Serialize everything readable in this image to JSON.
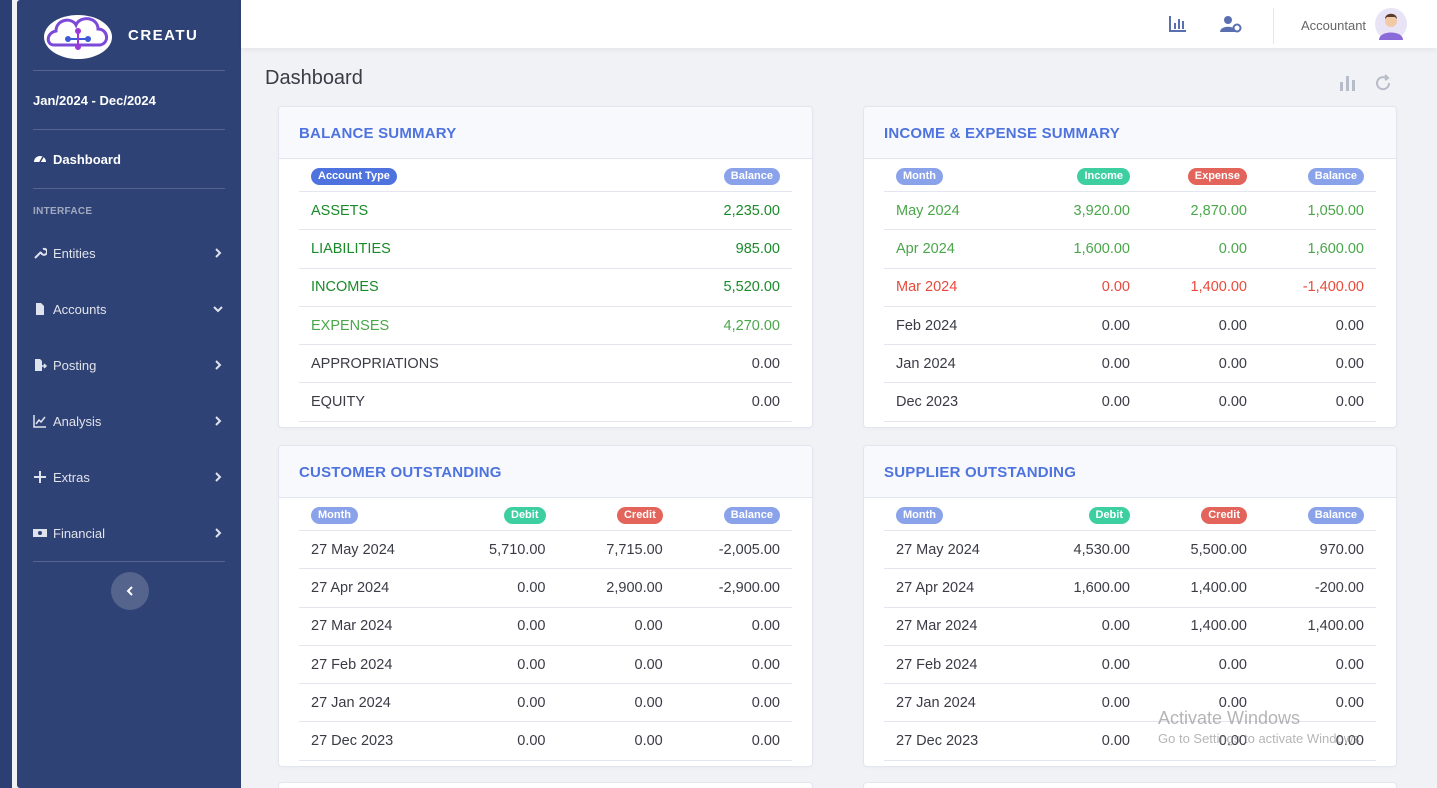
{
  "app": {
    "brand": "CREATU",
    "period": "Jan/2024 - Dec/2024"
  },
  "sidebar": {
    "dashboard_label": "Dashboard",
    "section_heading": "INTERFACE",
    "items": [
      {
        "label": "Entities",
        "icon": "wrench-icon",
        "chevron": "right"
      },
      {
        "label": "Accounts",
        "icon": "file-icon",
        "chevron": "down"
      },
      {
        "label": "Posting",
        "icon": "file-export-icon",
        "chevron": "right"
      },
      {
        "label": "Analysis",
        "icon": "chart-area-icon",
        "chevron": "right"
      },
      {
        "label": "Extras",
        "icon": "plus-icon",
        "chevron": "right"
      },
      {
        "label": "Financial",
        "icon": "money-icon",
        "chevron": "right"
      }
    ]
  },
  "topbar": {
    "user_name": "Accountant"
  },
  "page": {
    "title": "Dashboard"
  },
  "balance_summary": {
    "title": "BALANCE SUMMARY",
    "headers": [
      "Account Type",
      "Balance"
    ],
    "rows": [
      {
        "type": "ASSETS",
        "balance": "2,235.00",
        "tone": "green"
      },
      {
        "type": "LIABILITIES",
        "balance": "985.00",
        "tone": "green"
      },
      {
        "type": "INCOMES",
        "balance": "5,520.00",
        "tone": "green"
      },
      {
        "type": "EXPENSES",
        "balance": "4,270.00",
        "tone": "lgreen"
      },
      {
        "type": "APPROPRIATIONS",
        "balance": "0.00",
        "tone": "dark"
      },
      {
        "type": "EQUITY",
        "balance": "0.00",
        "tone": "dark"
      }
    ]
  },
  "income_expense_summary": {
    "title": "INCOME & EXPENSE SUMMARY",
    "headers": [
      "Month",
      "Income",
      "Expense",
      "Balance"
    ],
    "rows": [
      {
        "month": "May 2024",
        "income": "3,920.00",
        "expense": "2,870.00",
        "balance": "1,050.00",
        "tone": "lgreen"
      },
      {
        "month": "Apr 2024",
        "income": "1,600.00",
        "expense": "0.00",
        "balance": "1,600.00",
        "tone": "lgreen"
      },
      {
        "month": "Mar 2024",
        "income": "0.00",
        "expense": "1,400.00",
        "balance": "-1,400.00",
        "tone": "red"
      },
      {
        "month": "Feb 2024",
        "income": "0.00",
        "expense": "0.00",
        "balance": "0.00",
        "tone": "dark"
      },
      {
        "month": "Jan 2024",
        "income": "0.00",
        "expense": "0.00",
        "balance": "0.00",
        "tone": "dark"
      },
      {
        "month": "Dec 2023",
        "income": "0.00",
        "expense": "0.00",
        "balance": "0.00",
        "tone": "dark"
      }
    ]
  },
  "customer_outstanding": {
    "title": "CUSTOMER OUTSTANDING",
    "headers": [
      "Month",
      "Debit",
      "Credit",
      "Balance"
    ],
    "rows": [
      {
        "month": "27 May 2024",
        "debit": "5,710.00",
        "credit": "7,715.00",
        "balance": "-2,005.00"
      },
      {
        "month": "27 Apr 2024",
        "debit": "0.00",
        "credit": "2,900.00",
        "balance": "-2,900.00"
      },
      {
        "month": "27 Mar 2024",
        "debit": "0.00",
        "credit": "0.00",
        "balance": "0.00"
      },
      {
        "month": "27 Feb 2024",
        "debit": "0.00",
        "credit": "0.00",
        "balance": "0.00"
      },
      {
        "month": "27 Jan 2024",
        "debit": "0.00",
        "credit": "0.00",
        "balance": "0.00"
      },
      {
        "month": "27 Dec 2023",
        "debit": "0.00",
        "credit": "0.00",
        "balance": "0.00"
      }
    ]
  },
  "supplier_outstanding": {
    "title": "SUPPLIER OUTSTANDING",
    "headers": [
      "Month",
      "Debit",
      "Credit",
      "Balance"
    ],
    "rows": [
      {
        "month": "27 May 2024",
        "debit": "4,530.00",
        "credit": "5,500.00",
        "balance": "970.00"
      },
      {
        "month": "27 Apr 2024",
        "debit": "1,600.00",
        "credit": "1,400.00",
        "balance": "-200.00"
      },
      {
        "month": "27 Mar 2024",
        "debit": "0.00",
        "credit": "1,400.00",
        "balance": "1,400.00"
      },
      {
        "month": "27 Feb 2024",
        "debit": "0.00",
        "credit": "0.00",
        "balance": "0.00"
      },
      {
        "month": "27 Jan 2024",
        "debit": "0.00",
        "credit": "0.00",
        "balance": "0.00"
      },
      {
        "month": "27 Dec 2023",
        "debit": "0.00",
        "credit": "0.00",
        "balance": "0.00"
      }
    ]
  },
  "watermark": {
    "line1": "Activate Windows",
    "line2": "Go to Settings to activate Windows."
  },
  "colors": {
    "sidebar": "#2f4275",
    "accent": "#4e73df",
    "positive": "#1a8a2a",
    "negative": "#e74a3b"
  }
}
